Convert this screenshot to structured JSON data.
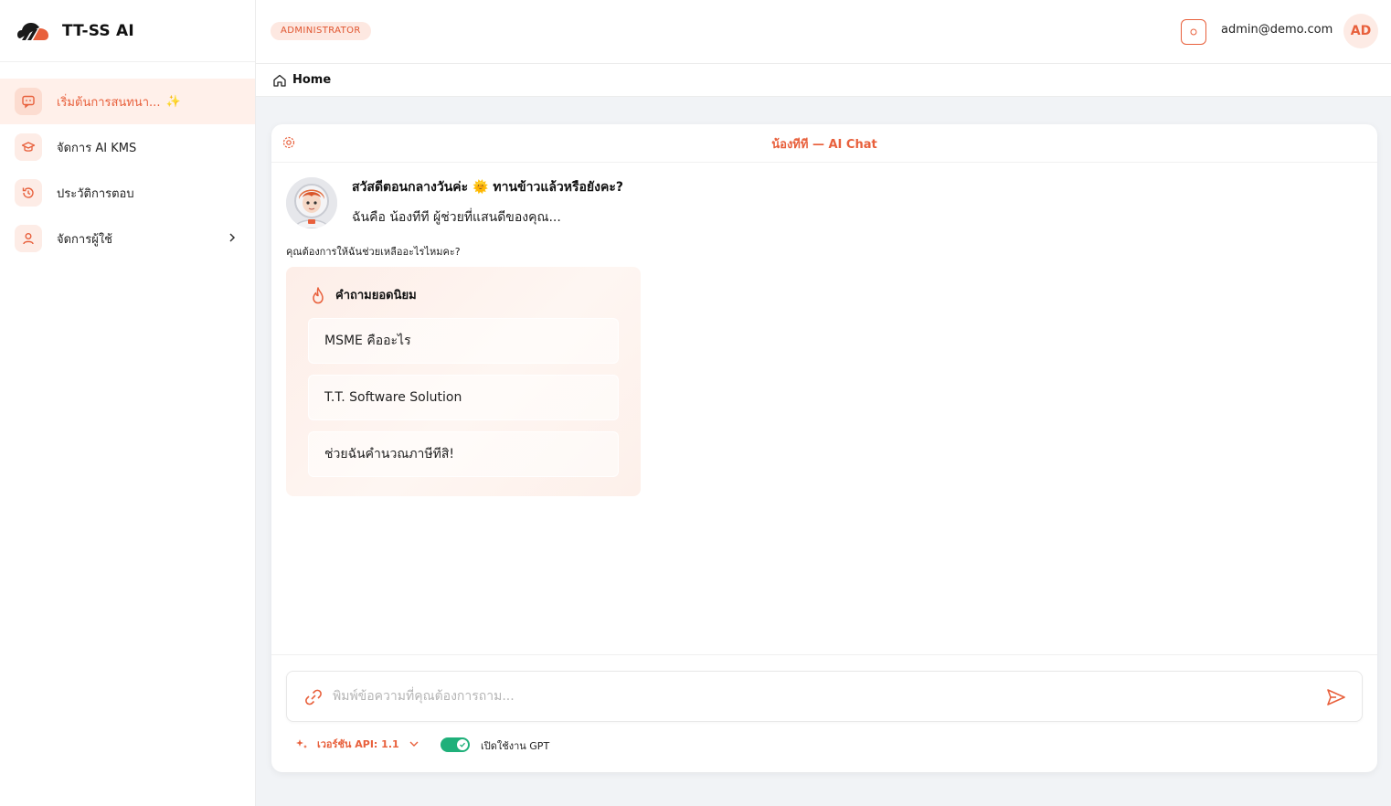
{
  "app": {
    "name": "TT-SS AI"
  },
  "sidebar": {
    "items": [
      {
        "label": "เริ่มต้นการสนทนา...",
        "suffix": "✨",
        "icon": "chat-bubble-icon",
        "active": true
      },
      {
        "label": "จัดการ AI KMS",
        "icon": "graduation-cap-icon"
      },
      {
        "label": "ประวัติการตอบ",
        "icon": "history-icon"
      },
      {
        "label": "จัดการผู้ใช้",
        "icon": "user-icon",
        "expandable": true
      }
    ]
  },
  "topbar": {
    "role_badge": "ADMINISTRATOR",
    "user_email": "admin@demo.com",
    "avatar_initials": "AD"
  },
  "breadcrumb": {
    "home": "Home"
  },
  "chat": {
    "title": "น้องทีที — AI Chat",
    "greeting": "สวัสดีตอนกลางวันค่ะ 🌞 ทานข้าวแล้วหรือยังคะ?",
    "intro": "ฉันคือ น้องทีที ผู้ช่วยที่แสนดีของคุณ...",
    "help_prompt": "คุณต้องการให้ฉันช่วยเหลืออะไรไหมคะ?",
    "popular": {
      "title": "คำถามยอดนิยม",
      "questions": [
        "MSME คืออะไร",
        "T.T. Software Solution",
        "ช่วยฉันคำนวณภาษีทีสิ!"
      ]
    }
  },
  "composer": {
    "placeholder": "พิมพ์ข้อความที่คุณต้องการถาม...",
    "version_label": "เวอร์ชัน API: 1.1",
    "gpt_label": "เปิดใช้งาน GPT",
    "gpt_enabled": true
  },
  "colors": {
    "accent": "#e8603c",
    "toggle_on": "#1fb07a",
    "badge_bg": "#fde8e1"
  }
}
